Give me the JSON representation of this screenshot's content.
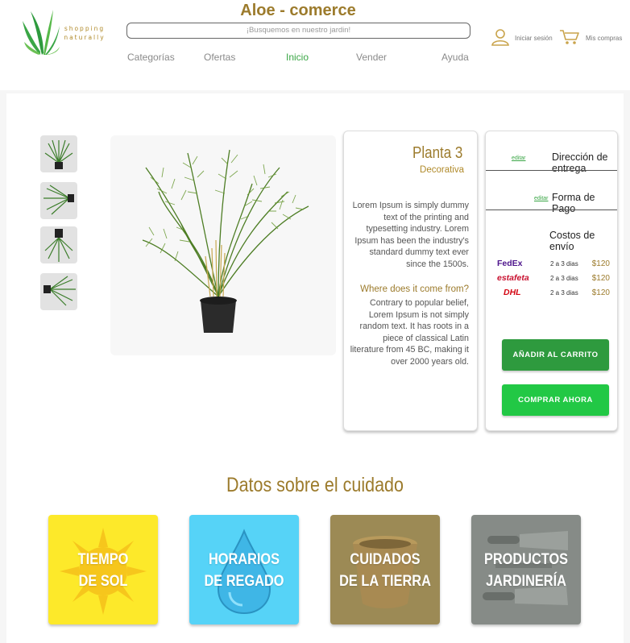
{
  "header": {
    "brand": "Aloe - comerce",
    "logo_text": "shopping naturally",
    "search_placeholder": "¡Busquemos en nuestro jardin!",
    "nav": [
      "Categorías",
      "Ofertas",
      "Inicio",
      "Vender",
      "Ayuda"
    ],
    "active_nav": "Inicio",
    "login_label": "Iniciar sesión",
    "cart_label": "Mis compras"
  },
  "product": {
    "title": "Planta 3",
    "subtitle": "Decorativa",
    "body1": "Lorem Ipsum is simply dummy text of the printing and typesetting industry. Lorem Ipsum has been the industry's standard dummy text ever since the 1500s.",
    "heading2": "Where does it come from?",
    "body2": "Contrary to popular belief, Lorem Ipsum is not simply random text. It has roots in a piece of classical Latin literature from 45 BC, making it over 2000 years old."
  },
  "purchase": {
    "edit_label": "editar",
    "address_label": "Dirección de entrega",
    "payment_label": "Forma de Pago",
    "shipping_title": "Costos de envío",
    "shipping": [
      {
        "carrier": "FedEx",
        "days": "2 a 3 dias",
        "price": "$120"
      },
      {
        "carrier": "estafeta",
        "days": "2 a 3 dias",
        "price": "$120"
      },
      {
        "carrier": "DHL",
        "days": "2 a 3 dias",
        "price": "$120"
      }
    ],
    "add_to_cart": "AÑADIR AL CARRITO",
    "buy_now": "COMPRAR AHORA"
  },
  "care": {
    "title": "Datos sobre el cuidado",
    "tiles": [
      {
        "label": "TIEMPO\nDE SOL"
      },
      {
        "label": "HORARIOS\nDE REGADO"
      },
      {
        "label": "CUIDADOS\nDE LA TIERRA"
      },
      {
        "label": "PRODUCTOS\nJARDINERÍA"
      }
    ]
  },
  "colors": {
    "accent_gold": "#9c7b2c",
    "green_dark": "#2e9a3e",
    "green_bright": "#22c845",
    "tile_sun": "#fde92a",
    "tile_water": "#56d3f7",
    "tile_soil": "#9c8a55",
    "tile_tools": "#868b87"
  },
  "icons": [
    "aloe-logo-icon",
    "user-icon",
    "cart-icon",
    "plant-thumbnail",
    "sun-icon",
    "water-drop-icon",
    "pot-icon",
    "garden-tools-icon"
  ]
}
